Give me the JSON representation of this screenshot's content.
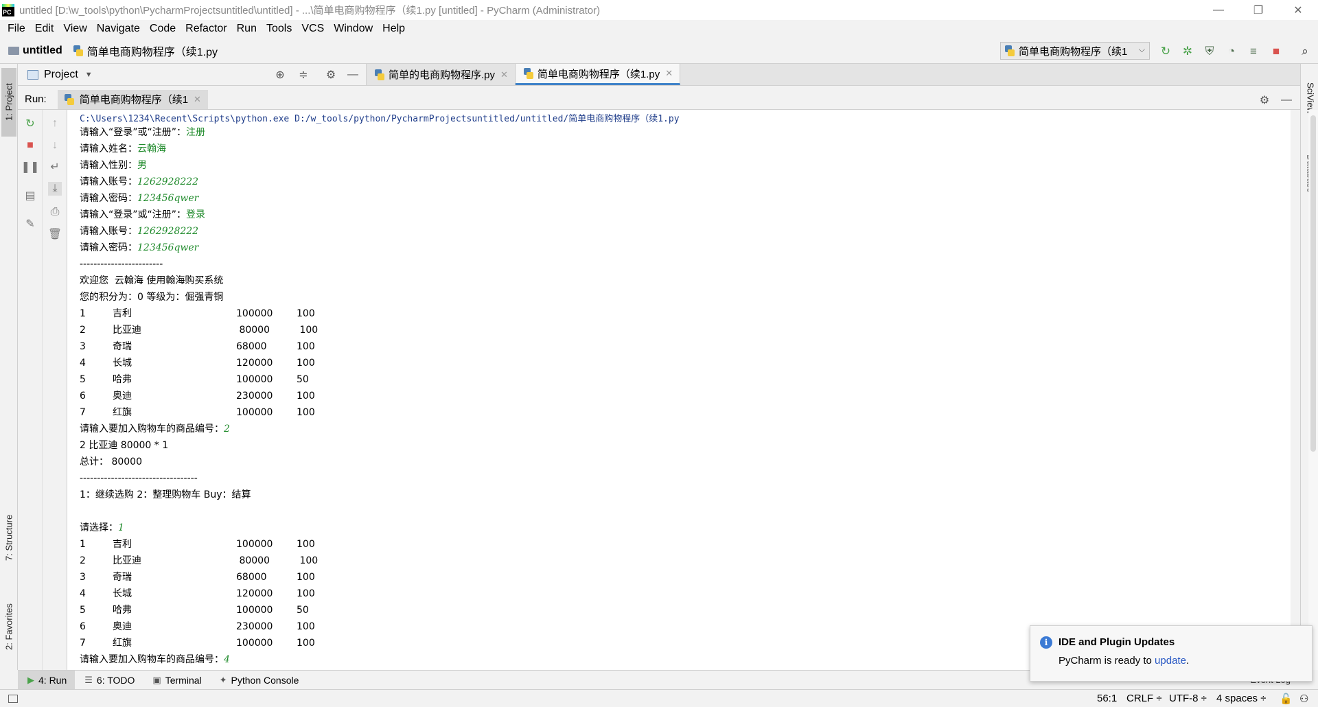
{
  "window": {
    "title": "untitled [D:\\w_tools\\python\\PycharmProjectsuntitled\\untitled] - ...\\简单电商购物程序（续1.py [untitled] - PyCharm (Administrator)",
    "logo_text": "PC",
    "minimize_glyph": "—",
    "restore_glyph": "❐",
    "close_glyph": "✕"
  },
  "menu": [
    "File",
    "Edit",
    "View",
    "Navigate",
    "Code",
    "Refactor",
    "Run",
    "Tools",
    "VCS",
    "Window",
    "Help"
  ],
  "navbar": {
    "project": "untitled",
    "file": "简单电商购物程序（续1.py",
    "run_config": "简单电商购物程序（续1"
  },
  "left_tabs": {
    "project": "1: Project",
    "structure": "7: Structure",
    "favorites": "2: Favorites"
  },
  "right_tabs": {
    "sciview": "SciView",
    "database": "Database"
  },
  "project_panel": {
    "label": "Project"
  },
  "editor_tabs": [
    {
      "label": "简单的电商购物程序.py",
      "active": false
    },
    {
      "label": "简单电商购物程序（续1.py",
      "active": true
    }
  ],
  "run_panel": {
    "label": "Run:",
    "tab": "简单电商购物程序（续1"
  },
  "console": {
    "cmd": "C:\\Users\\1234\\Recent\\Scripts\\python.exe D:/w_tools/python/PycharmProjectsuntitled/untitled/简单电商购物程序（续1.py",
    "prompt_login_or_register": "请输入“登录”或“注册”：",
    "input_register": "注册",
    "prompt_name": "请输入姓名：",
    "input_name": "云翰海",
    "prompt_gender": "请输入性别：",
    "input_gender": "男",
    "prompt_account": "请输入账号：",
    "input_account": "1262928222",
    "prompt_password": "请输入密码：",
    "input_password": "123456qwer",
    "input_login": "登录",
    "separator_short": "------------------------",
    "welcome": "欢迎您  云翰海 使用翰海购买系统",
    "points_level": "您的积分为：0 等级为：倔强青铜",
    "products": [
      {
        "id": "1",
        "name": "吉利",
        "price": "100000",
        "stock": "100"
      },
      {
        "id": "2",
        "name": "比亚迪",
        "price": " 80000",
        "stock": " 100"
      },
      {
        "id": "3",
        "name": "奇瑞",
        "price": "68000",
        "stock": "100"
      },
      {
        "id": "4",
        "name": "长城",
        "price": "120000",
        "stock": "100"
      },
      {
        "id": "5",
        "name": "哈弗",
        "price": "100000",
        "stock": "50"
      },
      {
        "id": "6",
        "name": "奥迪",
        "price": "230000",
        "stock": "100"
      },
      {
        "id": "7",
        "name": "红旗",
        "price": "100000",
        "stock": "100"
      }
    ],
    "prompt_add_to_cart": "请输入要加入购物车的商品编号：",
    "input_product_1": "2",
    "cart_line": "2 比亚迪 80000 * 1",
    "total": "总计： 80000",
    "separator_long": "----------------------------------",
    "options": "1：继续选购 2：整理购物车 Buy：结算",
    "prompt_choose": "请选择：",
    "input_choice": "1",
    "input_product_2": "4"
  },
  "bottom_tabs": [
    {
      "label": "4: Run",
      "active": true
    },
    {
      "label": "6: TODO",
      "active": false
    },
    {
      "label": "Terminal",
      "active": false
    },
    {
      "label": "Python Console",
      "active": false
    }
  ],
  "event_log": "Event Log",
  "status": {
    "position": "56:1",
    "line_sep": "CRLF ÷",
    "encoding": "UTF-8 ÷",
    "indent": "4 spaces ÷"
  },
  "notification": {
    "title": "IDE and Plugin Updates",
    "body_prefix": "PyCharm is ready to ",
    "link": "update",
    "body_suffix": "."
  },
  "colors": {
    "accent": "#4083c9",
    "input_text": "#1e8a2a",
    "path_text": "#1f3d8a",
    "stop_red": "#d9534f",
    "run_green": "#4aa24a"
  }
}
